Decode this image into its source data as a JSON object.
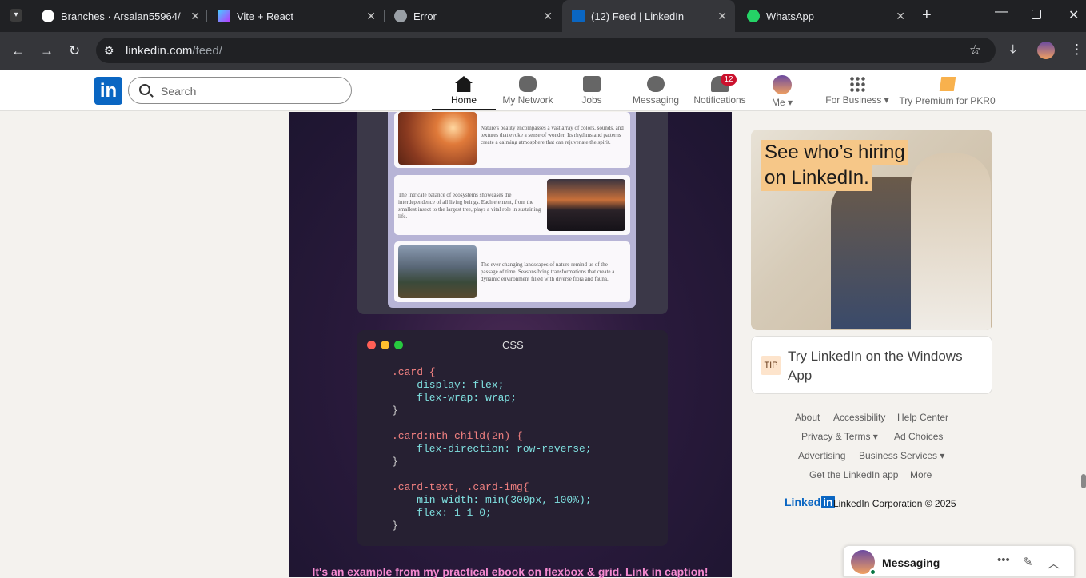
{
  "browser": {
    "tabs": [
      {
        "title": "Branches · Arsalan55964/e-c",
        "icon": "github-icon"
      },
      {
        "title": "Vite + React",
        "icon": "vite-icon"
      },
      {
        "title": "Error",
        "icon": "globe-icon"
      },
      {
        "title": "(12) Feed | LinkedIn",
        "icon": "linkedin-icon",
        "active": true
      },
      {
        "title": "WhatsApp",
        "icon": "whatsapp-icon"
      }
    ],
    "url_host": "linkedin.com",
    "url_path": "/feed/"
  },
  "linkedin": {
    "logo": "in",
    "search_placeholder": "Search",
    "nav": [
      {
        "label": "Home",
        "icon": "home-icon"
      },
      {
        "label": "My Network",
        "icon": "network-icon"
      },
      {
        "label": "Jobs",
        "icon": "briefcase-icon"
      },
      {
        "label": "Messaging",
        "icon": "chat-icon"
      },
      {
        "label": "Notifications",
        "icon": "bell-icon"
      },
      {
        "label": "Me",
        "icon": "avatar"
      },
      {
        "label": "For Business",
        "icon": "grid-icon"
      },
      {
        "label": "Try Premium for PKR0",
        "icon": "premium-icon"
      }
    ],
    "notifications_count": "12",
    "accent": "#0a66c2"
  },
  "post": {
    "cards": [
      {
        "text": "Nature's beauty encompasses a vast array of colors, sounds, and textures that evoke a sense of wonder. Its rhythms and patterns create a calming atmosphere that can rejuvenate the spirit."
      },
      {
        "text": "The intricate balance of ecosystems showcases the interdependence of all living beings. Each element, from the smallest insect to the largest tree, plays a vital role in sustaining life."
      },
      {
        "text": "The ever-changing landscapes of nature remind us of the passage of time. Seasons bring transformations that create a dynamic environment filled with diverse flora and fauna."
      }
    ],
    "code_lang": "CSS",
    "code_lines": [
      ".card {",
      "    display: flex;",
      "    flex-wrap: wrap;",
      "}",
      "",
      ".card:nth-child(2n) {",
      "    flex-direction: row-reverse;",
      "}",
      "",
      ".card-text, .card-img{",
      "    min-width: min(300px, 100%);",
      "    flex: 1 1 0;",
      "}"
    ],
    "caption": "It's an example from my practical ebook on flexbox & grid. Link in caption!"
  },
  "sidebar": {
    "ad_line1": "See who’s hiring",
    "ad_line2": "on LinkedIn.",
    "tip_badge": "TIP",
    "tip_text": "Try LinkedIn on the Windows App",
    "footer_links": [
      "About",
      "Accessibility",
      "Help Center",
      "Privacy & Terms",
      "Ad Choices",
      "Advertising",
      "Business Services",
      "Get the LinkedIn app",
      "More"
    ],
    "brand": "Linked",
    "brand_in": "in",
    "copyright": "LinkedIn Corporation © 2025"
  },
  "messaging": {
    "label": "Messaging"
  }
}
